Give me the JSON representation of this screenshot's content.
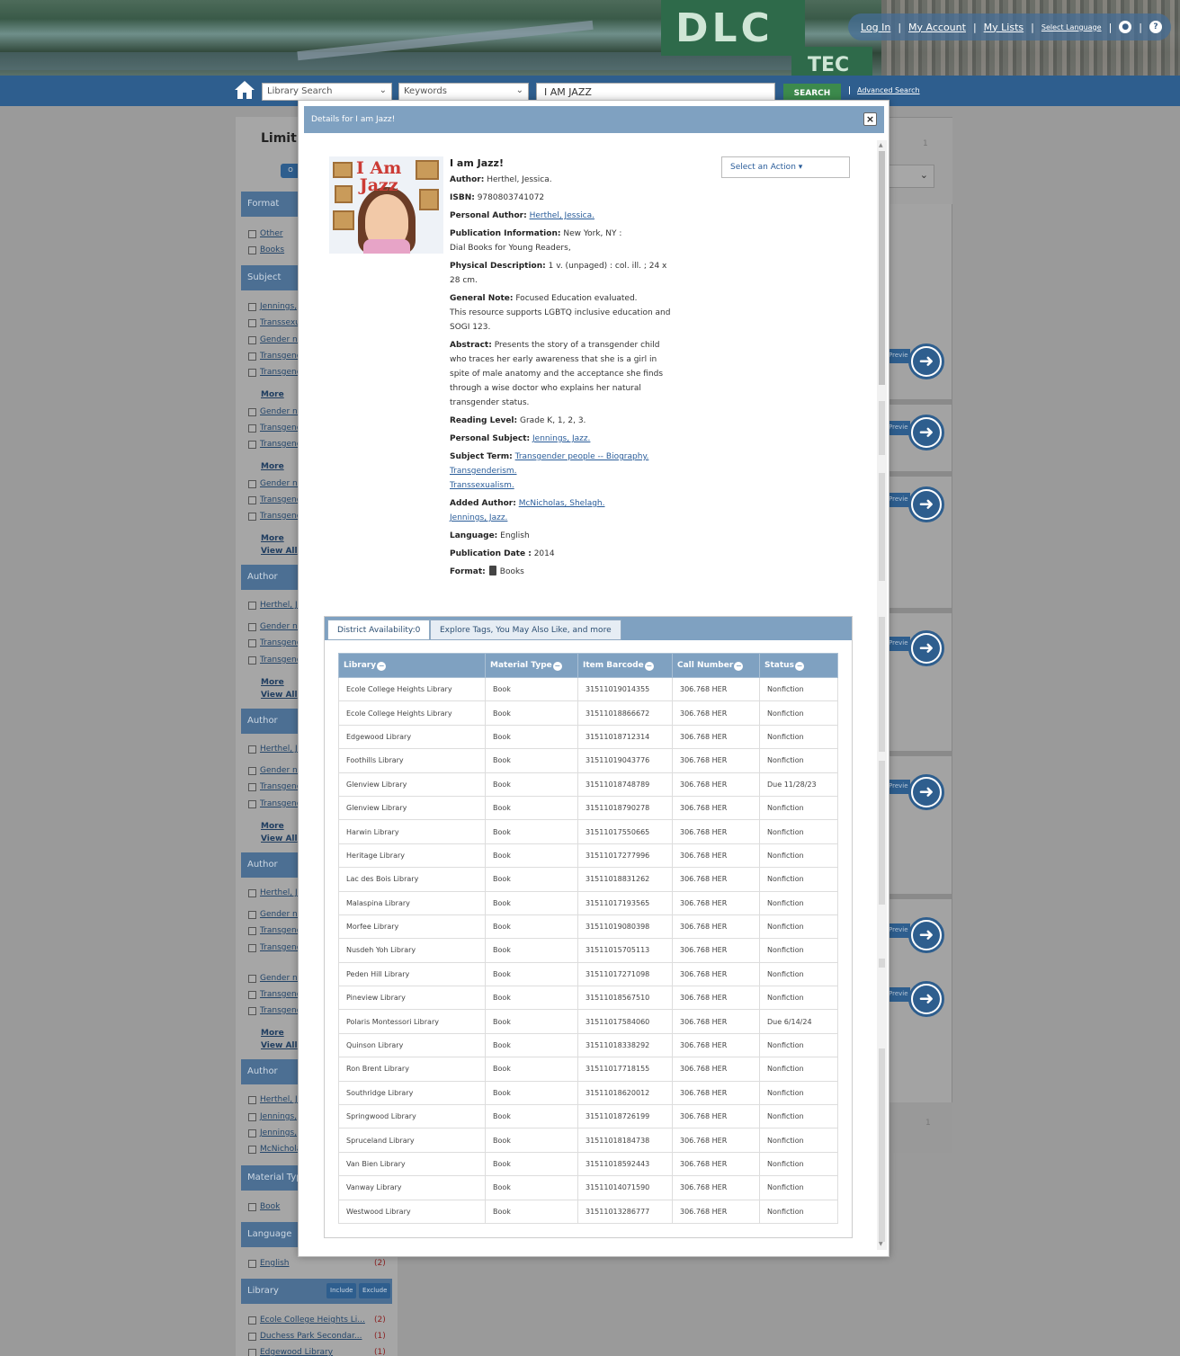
{
  "header": {
    "banner_sign": "DLC",
    "banner_sign2": "TEC",
    "links": [
      "Log In",
      "My Account",
      "My Lists",
      "Select Language"
    ],
    "search": {
      "scope": "Library Search",
      "field": "Keywords",
      "query": "I AM JAZZ",
      "button": "SEARCH",
      "advanced": "Advanced Search"
    }
  },
  "sidebar": {
    "title": "Limit S",
    "button": "O",
    "include": "Include",
    "exclude": "Exclude",
    "more": "More",
    "view_all": "View All",
    "facets": [
      {
        "head": "Format",
        "items": [
          "Other",
          "Books"
        ]
      },
      {
        "head": "Subject",
        "items": [
          "Jennings,",
          "Transsexu",
          "Gender no",
          "Transgend",
          "Transgend",
          "Gender no",
          "Transgend",
          "Transgend",
          "Gender no",
          "Transgend",
          "Transgend"
        ]
      },
      {
        "head": "Author",
        "items": [
          "Herthel, Je",
          "Gender no",
          "Transgend",
          "Transgend"
        ]
      },
      {
        "head": "Author",
        "items": [
          "Herthel, Je",
          "Gender no",
          "Transgend",
          "Transgend"
        ]
      },
      {
        "head": "Author",
        "items": [
          "Herthel, Je",
          "Gender no",
          "Transgend",
          "Transgend",
          "Gender no",
          "Transgend",
          "Transgend"
        ]
      },
      {
        "head": "Author",
        "items": [
          "Herthel, Je",
          "Jennings,",
          "Jennings,",
          "McNichola"
        ]
      },
      {
        "head": "Material Type",
        "items": [
          "Book"
        ]
      },
      {
        "head": "Language",
        "items": [
          "English"
        ],
        "counts": [
          "(2)"
        ]
      },
      {
        "head": "Library",
        "items": [
          "Ecole College Heights Li...",
          "Duchess Park Secondar...",
          "Edgewood Library"
        ],
        "counts": [
          "(2)",
          "(1)",
          "(1)"
        ]
      }
    ]
  },
  "results": {
    "page_number_top": "1",
    "page_number_bottom": "1",
    "preview_label": "Previe"
  },
  "modal": {
    "title": "Details for I am Jazz!",
    "close": "×",
    "cover": {
      "title_line1": "I Am",
      "title_line2": "Jazz"
    },
    "action_select": "Select an Action",
    "record": {
      "title": "I am Jazz!",
      "author_label": "Author:",
      "author": "Herthel, Jessica.",
      "isbn_label": "ISBN:",
      "isbn": "9780803741072",
      "personal_author_label": "Personal Author:",
      "personal_author": "Herthel, Jessica.",
      "pub_info_label": "Publication Information:",
      "pub_info_1": "New York, NY :",
      "pub_info_2": "Dial Books for Young Readers,",
      "phys_desc_label": "Physical Description:",
      "phys_desc": "1 v. (unpaged) : col. ill. ; 24 x 28 cm.",
      "general_note_label": "General Note:",
      "general_note_1": "Focused Education evaluated.",
      "general_note_2": "This resource supports LGBTQ inclusive education and SOGI 123.",
      "abstract_label": "Abstract:",
      "abstract": "Presents the story of a transgender child who traces her early awareness that she is a girl in spite of male anatomy and the acceptance she finds through a wise doctor who explains her natural transgender status.",
      "reading_level_label": "Reading Level:",
      "reading_level": "Grade K, 1, 2, 3.",
      "personal_subject_label": "Personal Subject:",
      "personal_subject": "Jennings, Jazz.",
      "subject_term_label": "Subject Term:",
      "subject_terms": [
        "Transgender people -- Biography.",
        "Transgenderism.",
        "Transsexualism."
      ],
      "added_author_label": "Added Author:",
      "added_authors": [
        "McNicholas, Shelagh.",
        "Jennings, Jazz."
      ],
      "language_label": "Language:",
      "language": "English",
      "pub_date_label": "Publication Date :",
      "pub_date": "2014",
      "format_label": "Format:",
      "format": "Books"
    },
    "tabs": [
      "District Availability:0",
      "Explore Tags, You May Also Like, and more"
    ],
    "table": {
      "columns": [
        "Library",
        "Material Type",
        "Item Barcode",
        "Call Number",
        "Status"
      ],
      "rows": [
        [
          "Ecole College Heights Library",
          "Book",
          "31511019014355",
          "306.768 HER",
          "Nonfiction"
        ],
        [
          "Ecole College Heights Library",
          "Book",
          "31511018866672",
          "306.768 HER",
          "Nonfiction"
        ],
        [
          "Edgewood Library",
          "Book",
          "31511018712314",
          "306.768 HER",
          "Nonfiction"
        ],
        [
          "Foothills Library",
          "Book",
          "31511019043776",
          "306.768 HER",
          "Nonfiction"
        ],
        [
          "Glenview Library",
          "Book",
          "31511018748789",
          "306.768 HER",
          "Due 11/28/23"
        ],
        [
          "Glenview Library",
          "Book",
          "31511018790278",
          "306.768 HER",
          "Nonfiction"
        ],
        [
          "Harwin Library",
          "Book",
          "31511017550665",
          "306.768 HER",
          "Nonfiction"
        ],
        [
          "Heritage Library",
          "Book",
          "31511017277996",
          "306.768 HER",
          "Nonfiction"
        ],
        [
          "Lac des Bois Library",
          "Book",
          "31511018831262",
          "306.768 HER",
          "Nonfiction"
        ],
        [
          "Malaspina Library",
          "Book",
          "31511017193565",
          "306.768 HER",
          "Nonfiction"
        ],
        [
          "Morfee Library",
          "Book",
          "31511019080398",
          "306.768 HER",
          "Nonfiction"
        ],
        [
          "Nusdeh Yoh Library",
          "Book",
          "31511015705113",
          "306.768 HER",
          "Nonfiction"
        ],
        [
          "Peden Hill Library",
          "Book",
          "31511017271098",
          "306.768 HER",
          "Nonfiction"
        ],
        [
          "Pineview Library",
          "Book",
          "31511018567510",
          "306.768 HER",
          "Nonfiction"
        ],
        [
          "Polaris Montessori Library",
          "Book",
          "31511017584060",
          "306.768 HER",
          "Due 6/14/24"
        ],
        [
          "Quinson Library",
          "Book",
          "31511018338292",
          "306.768 HER",
          "Nonfiction"
        ],
        [
          "Ron Brent Library",
          "Book",
          "31511017718155",
          "306.768 HER",
          "Nonfiction"
        ],
        [
          "Southridge Library",
          "Book",
          "31511018620012",
          "306.768 HER",
          "Nonfiction"
        ],
        [
          "Springwood Library",
          "Book",
          "31511018726199",
          "306.768 HER",
          "Nonfiction"
        ],
        [
          "Spruceland Library",
          "Book",
          "31511018184738",
          "306.768 HER",
          "Nonfiction"
        ],
        [
          "Van Bien Library",
          "Book",
          "31511018592443",
          "306.768 HER",
          "Nonfiction"
        ],
        [
          "Vanway Library",
          "Book",
          "31511014071590",
          "306.768 HER",
          "Nonfiction"
        ],
        [
          "Westwood Library",
          "Book",
          "31511013286777",
          "306.768 HER",
          "Nonfiction"
        ]
      ]
    }
  }
}
